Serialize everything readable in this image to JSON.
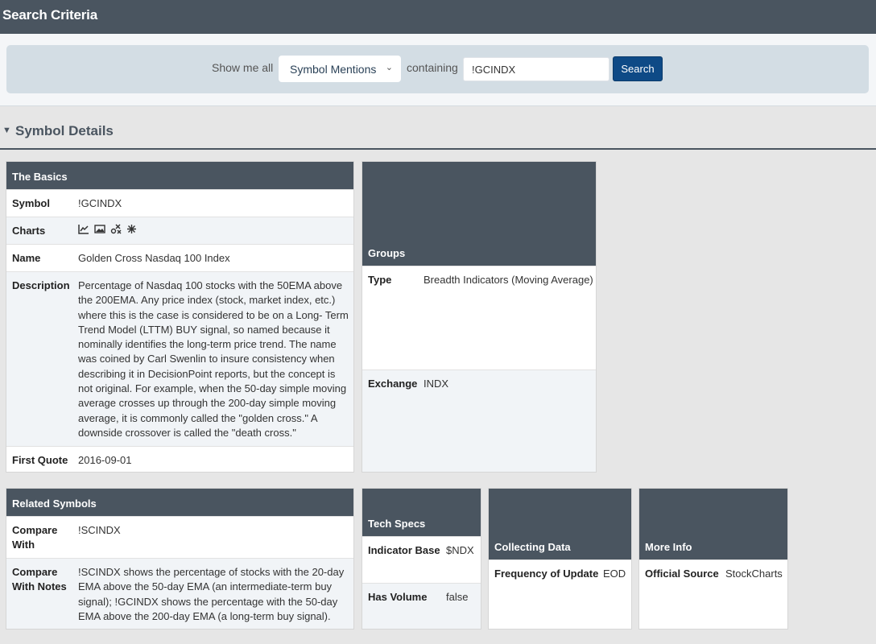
{
  "header": {
    "title": "Search Criteria"
  },
  "search": {
    "show_me_all": "Show me all",
    "select_value": "Symbol Mentions",
    "containing": "containing",
    "query": "!GCINDX",
    "button": "Search"
  },
  "section": {
    "title": "Symbol Details"
  },
  "basics": {
    "title": "The Basics",
    "symbol_label": "Symbol",
    "symbol": "!GCINDX",
    "charts_label": "Charts",
    "chart_icons": [
      "line-chart-icon",
      "image-chart-icon",
      "point-figure-icon",
      "seasonality-icon"
    ],
    "name_label": "Name",
    "name": "Golden Cross Nasdaq 100 Index",
    "description_label": "Description",
    "description": "Percentage of Nasdaq 100 stocks with the 50EMA above the 200EMA. Any price index (stock, market index, etc.) where this is the case is considered to be on a Long- Term Trend Model (LTTM) BUY signal, so named because it nominally identifies the long-term price trend. The name was coined by Carl Swenlin to insure consistency when describing it in DecisionPoint reports, but the concept is not original. For example, when the 50-day simple moving average crosses up through the 200-day simple moving average, it is commonly called the \"golden cross.\" A downside crossover is called the \"death cross.\"",
    "first_quote_label": "First Quote",
    "first_quote": "2016-09-01"
  },
  "groups": {
    "title": "Groups",
    "type_label": "Type",
    "type": "Breadth Indicators (Moving Average)",
    "exchange_label": "Exchange",
    "exchange": "INDX"
  },
  "related": {
    "title": "Related Symbols",
    "compare_label": "Compare With",
    "compare": "!SCINDX",
    "notes_label": "Compare With Notes",
    "notes": "!SCINDX shows the percentage of stocks with the 20-day EMA above the 50-day EMA (an intermediate-term buy signal); !GCINDX shows the percentage with the 50-day EMA above the 200-day EMA (a long-term buy signal)."
  },
  "tech_specs": {
    "title": "Tech Specs",
    "base_label": "Indicator Base",
    "base": "$NDX",
    "volume_label": "Has Volume",
    "volume": "false"
  },
  "collecting": {
    "title": "Collecting Data",
    "freq_label": "Frequency of Update",
    "freq": "EOD"
  },
  "more_info": {
    "title": "More Info",
    "source_label": "Official Source",
    "source": "StockCharts"
  }
}
